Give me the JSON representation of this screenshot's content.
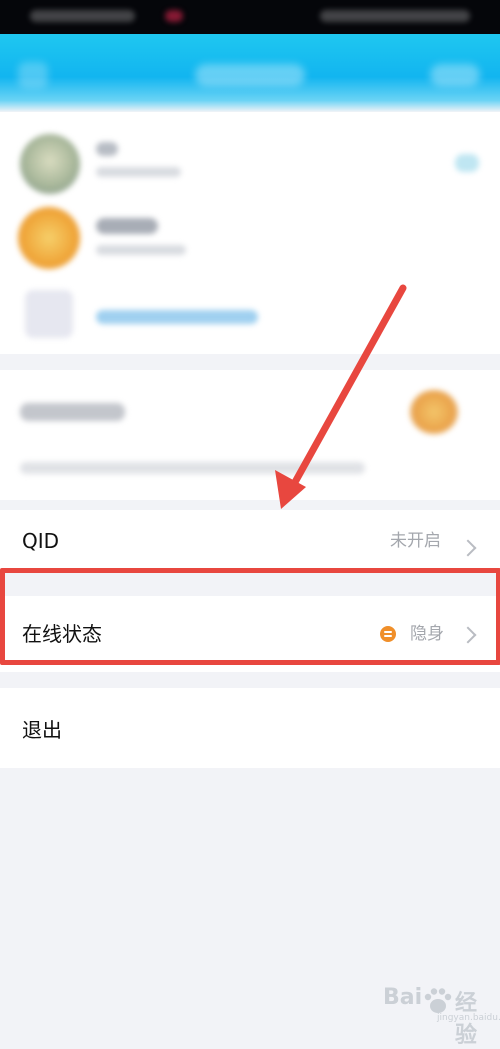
{
  "rows": {
    "qid": {
      "label": "QID",
      "value": "未开启"
    },
    "online_status": {
      "label": "在线状态",
      "value": "隐身",
      "status_icon": "invisible-status-icon",
      "status_color": "#f08f2a"
    },
    "logout": {
      "label": "退出"
    }
  },
  "annotation": {
    "color": "#e8473f",
    "highlight": "online_status"
  },
  "watermark": {
    "text": "Bai",
    "text2": "经验",
    "sub": "jingyan.baidu.com"
  },
  "header": {
    "background": "#12b5f0"
  }
}
